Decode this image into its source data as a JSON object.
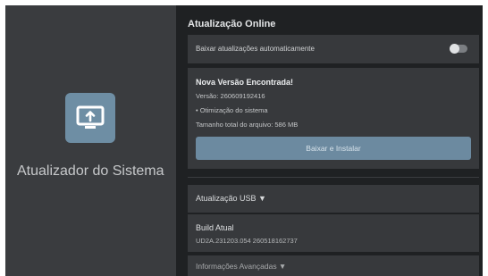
{
  "app": {
    "title": "Atualizador do Sistema",
    "icon": "system-update-icon"
  },
  "online": {
    "section_title": "Atualização Online",
    "auto_update_label": "Baixar atualizações automaticamente",
    "auto_update_enabled": false
  },
  "update": {
    "heading": "Nova Versão Encontrada!",
    "version": "Versão: 260609192416",
    "notes": "• Otimização do sistema",
    "size": "Tamanho total do arquivo: 586 MB",
    "install_label": "Baixar e Instalar"
  },
  "usb": {
    "label": "Atualização USB ▼"
  },
  "build": {
    "title": "Build Atual",
    "value": "UD2A.231203.054 260518162737"
  },
  "more": {
    "label": "Informações Avançadas ▼"
  },
  "colors": {
    "left_panel": "#3a3c3f",
    "right_panel": "#1f2123",
    "card": "#37393c",
    "accent": "#6c8aa0"
  }
}
